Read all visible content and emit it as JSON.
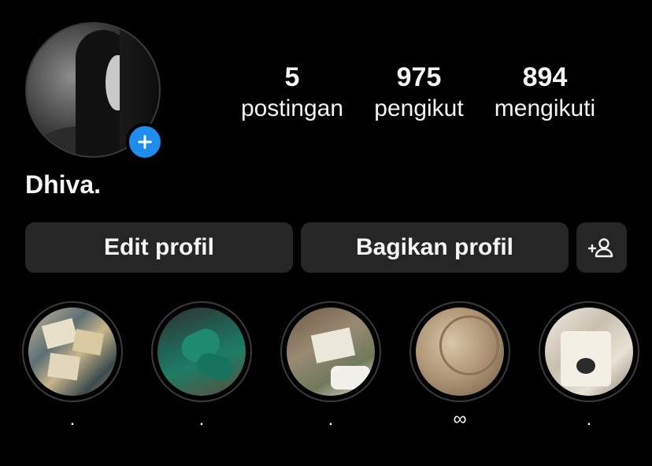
{
  "profile": {
    "name": "Dhiva.",
    "stats": {
      "posts": {
        "value": "5",
        "label": "postingan"
      },
      "followers": {
        "value": "975",
        "label": "pengikut"
      },
      "following": {
        "value": "894",
        "label": "mengikuti"
      }
    }
  },
  "actions": {
    "edit_label": "Edit profil",
    "share_label": "Bagikan profil",
    "add_person_icon": "add-person-icon"
  },
  "highlights": [
    {
      "label": "."
    },
    {
      "label": "."
    },
    {
      "label": "."
    },
    {
      "label": "∞"
    },
    {
      "label": "."
    }
  ],
  "colors": {
    "background": "#000000",
    "button_bg": "#262626",
    "accent_blue": "#1d8ef0",
    "text": "#f5f5f5"
  }
}
